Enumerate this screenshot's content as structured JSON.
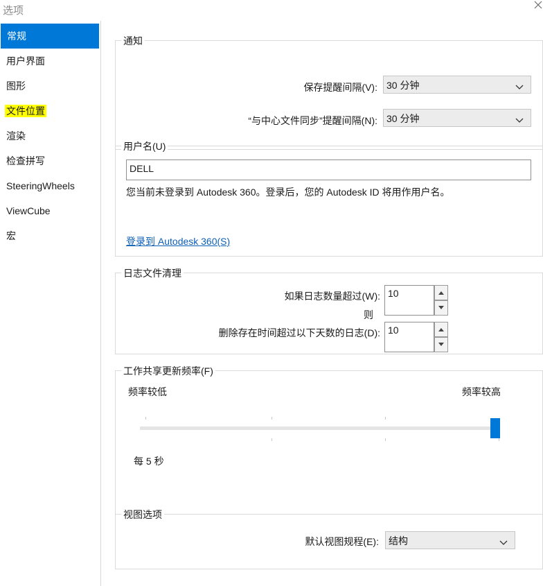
{
  "window": {
    "title": "选项"
  },
  "sidebar": {
    "items": [
      {
        "label": "常规",
        "selected": true
      },
      {
        "label": "用户界面"
      },
      {
        "label": "图形"
      },
      {
        "label": "文件位置",
        "highlighted": true
      },
      {
        "label": "渲染"
      },
      {
        "label": "检查拼写"
      },
      {
        "label": "SteeringWheels"
      },
      {
        "label": "ViewCube"
      },
      {
        "label": "宏"
      }
    ]
  },
  "notify": {
    "title": "通知",
    "save_label": "保存提醒间隔(V):",
    "save_value": "30 分钟",
    "sync_label": "“与中心文件同步”提醒间隔(N):",
    "sync_value": "30 分钟"
  },
  "username": {
    "title": "用户名(U)",
    "value": "DELL",
    "info": "您当前未登录到 Autodesk 360。登录后，您的 Autodesk ID 将用作用户名。",
    "login_link": "登录到 Autodesk 360(S)"
  },
  "journal": {
    "title": "日志文件清理",
    "count_label": "如果日志数量超过(W):",
    "count_value": "10",
    "then": "则",
    "days_label": "删除存在时间超过以下天数的日志(D):",
    "days_value": "10"
  },
  "worksharing": {
    "title": "工作共享更新频率(F)",
    "low": "频率较低",
    "high": "频率较高",
    "value_text": "每 5 秒",
    "slider_fraction": 1.0
  },
  "view": {
    "title": "视图选项",
    "discipline_label": "默认视图规程(E):",
    "discipline_value": "结构"
  },
  "colors": {
    "accent": "#0078d7",
    "highlight": "#ffff00",
    "link": "#0b5fb5"
  }
}
